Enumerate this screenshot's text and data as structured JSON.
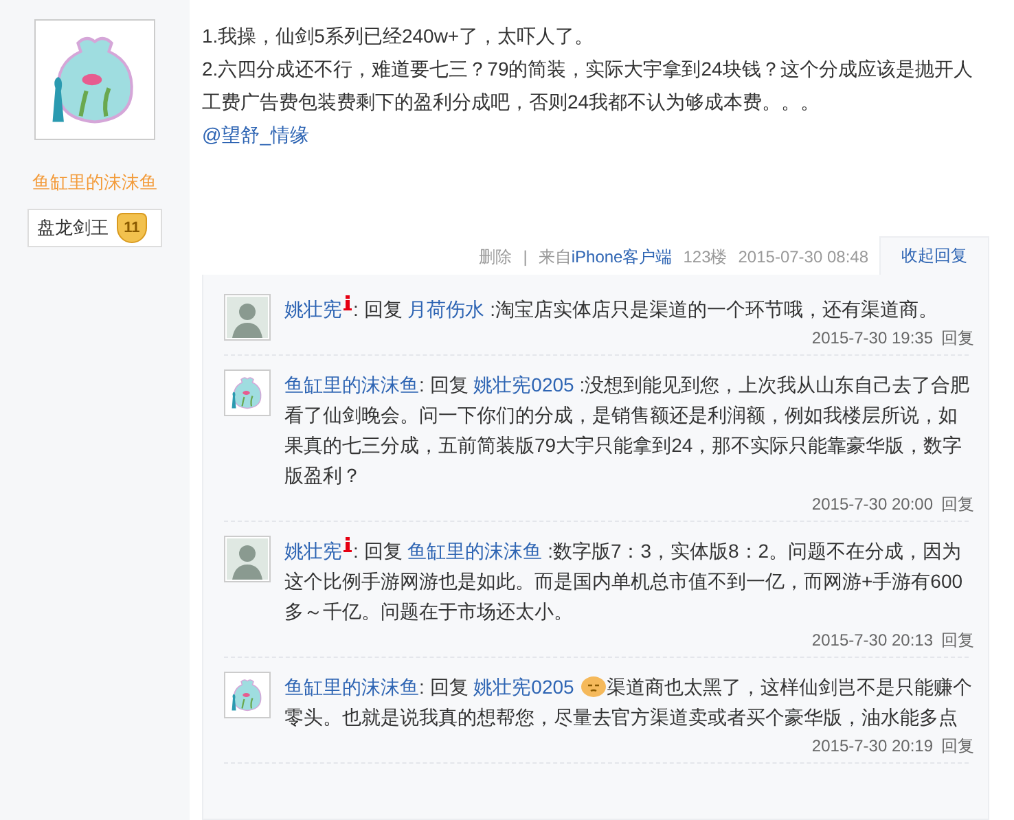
{
  "author": {
    "name": "鱼缸里的沫沫鱼",
    "title": "盘龙剑王",
    "level": "11"
  },
  "post": {
    "paragraphs": [
      "1.我操，仙剑5系列已经240w+了，太吓人了。",
      "2.六四分成还不行，难道要七三？79的简装，实际大宇拿到24块钱？这个分成应该是抛开人工费广告费包装费剩下的盈利分成吧，否则24我都不认为够成本费。。。"
    ],
    "mention": "@望舒_情缘"
  },
  "footer": {
    "delete": "删除",
    "separator": "|",
    "source_prefix": "来自",
    "source": "iPhone客户端",
    "floor": "123楼",
    "time": "2015-07-30 08:48"
  },
  "toggle": "收起回复",
  "replies": [
    {
      "kind": "portrait",
      "author": "姚壮宪",
      "member_icon": true,
      "prefix": ": 回复",
      "target": "月荷伤水",
      "emoji": false,
      "content": ":淘宝店实体店只是渠道的一个环节哦，还有渠道商。",
      "time": "2015-7-30 19:35",
      "reply": "回复"
    },
    {
      "kind": "fishbowl",
      "author": "鱼缸里的沫沫鱼",
      "member_icon": false,
      "prefix": ": 回复",
      "target": "姚壮宪0205",
      "emoji": false,
      "content": ":没想到能见到您，上次我从山东自己去了合肥看了仙剑晚会。问一下你们的分成，是销售额还是利润额，例如我楼层所说，如果真的七三分成，五前简装版79大宇只能拿到24，那不实际只能靠豪华版，数字版盈利？",
      "time": "2015-7-30 20:00",
      "reply": "回复"
    },
    {
      "kind": "portrait",
      "author": "姚壮宪",
      "member_icon": true,
      "prefix": ": 回复",
      "target": "鱼缸里的沫沫鱼",
      "emoji": false,
      "content": ":数字版7：3，实体版8：2。问题不在分成，因为这个比例手游网游也是如此。而是国内单机总市值不到一亿，而网游+手游有600多～千亿。问题在于市场还太小。",
      "time": "2015-7-30 20:13",
      "reply": "回复"
    },
    {
      "kind": "fishbowl",
      "author": "鱼缸里的沫沫鱼",
      "member_icon": false,
      "prefix": ": 回复",
      "target": "姚壮宪0205",
      "emoji": true,
      "content": "渠道商也太黑了，这样仙剑岂不是只能赚个零头。也就是说我真的想帮您，尽量去官方渠道卖或者买个豪华版，油水能多点",
      "time": "2015-7-30 20:19",
      "reply": "回复"
    }
  ]
}
